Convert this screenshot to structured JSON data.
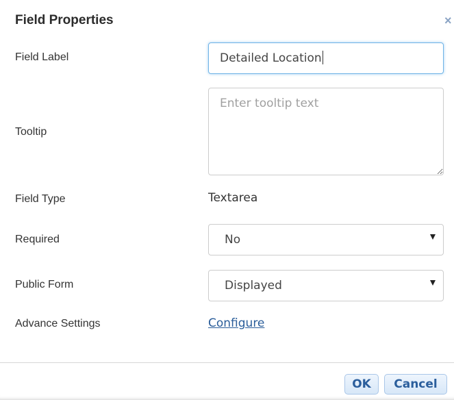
{
  "dialog": {
    "title": "Field Properties",
    "close_icon": "×"
  },
  "form": {
    "field_label": {
      "label": "Field Label",
      "value": "Detailed Location"
    },
    "tooltip": {
      "label": "Tooltip",
      "placeholder": "Enter tooltip text"
    },
    "field_type": {
      "label": "Field Type",
      "value": "Textarea"
    },
    "required": {
      "label": "Required",
      "selected": "No"
    },
    "public_form": {
      "label": "Public Form",
      "selected": "Displayed"
    },
    "advance_settings": {
      "label": "Advance Settings",
      "link": "Configure"
    }
  },
  "footer": {
    "ok_label": "OK",
    "cancel_label": "Cancel"
  },
  "colors": {
    "link": "#2a5d9a",
    "button_text": "#2b5e9c",
    "focus_border": "#6fb3e6"
  },
  "icons": {
    "close": "close-icon",
    "dropdown": "chevron-down-icon",
    "resize": "resize-handle-icon"
  }
}
